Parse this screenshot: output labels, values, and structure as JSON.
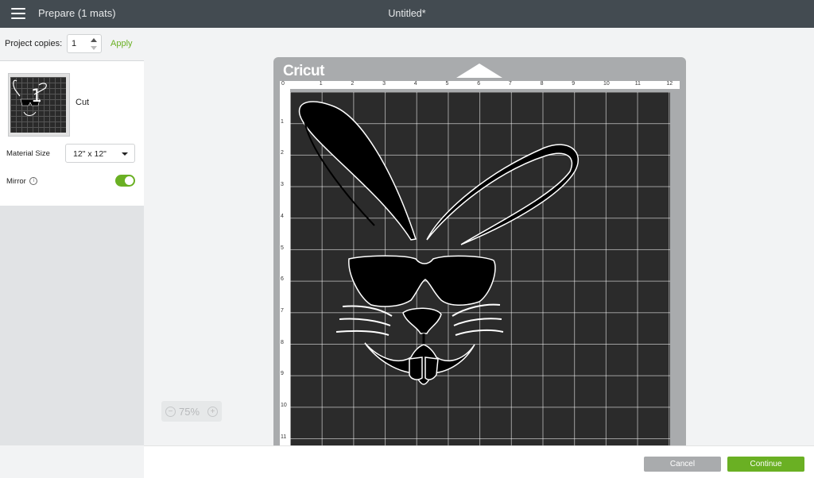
{
  "header": {
    "mode_title": "Prepare (1 mats)",
    "doc_title": "Untitled*",
    "menu_icon": "hamburger-icon"
  },
  "sidebar": {
    "copies_label": "Project copies:",
    "copies_value": "1",
    "apply_label": "Apply",
    "mat": {
      "number": "1",
      "operation": "Cut"
    },
    "material_label": "Material Size",
    "material_value": "12\" x 12\"",
    "mirror_label": "Mirror",
    "mirror_on": true
  },
  "canvas": {
    "brand": "Cricut",
    "zoom": "75%",
    "ruler_top": [
      "0",
      "1",
      "2",
      "3",
      "4",
      "5",
      "6",
      "7",
      "8",
      "9",
      "10",
      "11",
      "12"
    ],
    "ruler_left": [
      "1",
      "2",
      "3",
      "4",
      "5",
      "6",
      "7",
      "8",
      "9",
      "10",
      "11"
    ],
    "art_description_icon": "bunny-sunglasses-design"
  },
  "footer": {
    "cancel_label": "Cancel",
    "continue_label": "Continue"
  },
  "colors": {
    "accent": "#6ab023",
    "topbar": "#434b51",
    "mat": "#2b2b2b"
  }
}
